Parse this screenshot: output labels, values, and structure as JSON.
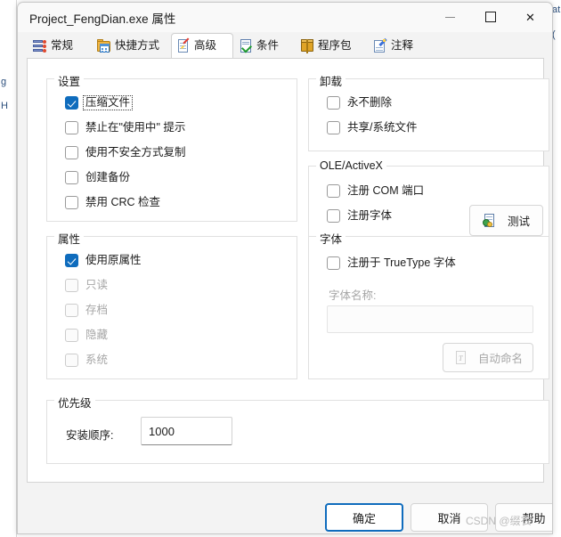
{
  "background": {
    "left_fragments": [
      "g",
      "H"
    ],
    "right_fragments": [
      "at",
      "("
    ]
  },
  "window": {
    "title": "Project_FengDian.exe 属性",
    "controls": {
      "minimize": "minimize-icon",
      "maximize": "maximize-icon",
      "close": "close-icon"
    }
  },
  "tabs": [
    {
      "label": "常规",
      "icon": "general-list-icon",
      "active": false
    },
    {
      "label": "快捷方式",
      "icon": "shortcut-folder-icon",
      "active": false
    },
    {
      "label": "高级",
      "icon": "advanced-doc-icon",
      "active": true
    },
    {
      "label": "条件",
      "icon": "condition-check-icon",
      "active": false
    },
    {
      "label": "程序包",
      "icon": "package-box-icon",
      "active": false
    },
    {
      "label": "注释",
      "icon": "comment-pencil-icon",
      "active": false
    }
  ],
  "groups": {
    "settings": {
      "legend": "设置",
      "items": [
        {
          "label": "压缩文件",
          "checked": true,
          "enabled": true,
          "focused": true
        },
        {
          "label": "禁止在\"使用中\" 提示",
          "checked": false,
          "enabled": true,
          "focused": false
        },
        {
          "label": "使用不安全方式复制",
          "checked": false,
          "enabled": true,
          "focused": false
        },
        {
          "label": "创建备份",
          "checked": false,
          "enabled": true,
          "focused": false
        },
        {
          "label": "禁用 CRC 检查",
          "checked": false,
          "enabled": true,
          "focused": false
        }
      ]
    },
    "attributes": {
      "legend": "属性",
      "items": [
        {
          "label": "使用原属性",
          "checked": true,
          "enabled": true,
          "focused": false
        },
        {
          "label": "只读",
          "checked": false,
          "enabled": false,
          "focused": false
        },
        {
          "label": "存档",
          "checked": false,
          "enabled": false,
          "focused": false
        },
        {
          "label": "隐藏",
          "checked": false,
          "enabled": false,
          "focused": false
        },
        {
          "label": "系统",
          "checked": false,
          "enabled": false,
          "focused": false
        }
      ]
    },
    "uninstall": {
      "legend": "卸载",
      "items": [
        {
          "label": "永不删除",
          "checked": false,
          "enabled": true
        },
        {
          "label": "共享/系统文件",
          "checked": false,
          "enabled": true
        }
      ]
    },
    "ole": {
      "legend": "OLE/ActiveX",
      "items": [
        {
          "label": "注册 COM 端口",
          "checked": false,
          "enabled": true
        },
        {
          "label": "注册字体",
          "checked": false,
          "enabled": true
        }
      ],
      "test_button": {
        "label": "测试",
        "icon": "test-doc-icon",
        "enabled": true
      }
    },
    "font": {
      "legend": "字体",
      "register_truetype": {
        "label": "注册于 TrueType 字体",
        "checked": false,
        "enabled": true
      },
      "name_label": "字体名称:",
      "name_value": "",
      "name_enabled": false,
      "auto_button": {
        "label": "自动命名",
        "icon": "auto-name-icon",
        "enabled": false
      }
    },
    "priority": {
      "legend": "优先级",
      "order_label": "安装顺序:",
      "order_value": "1000"
    }
  },
  "dialog_buttons": [
    {
      "label": "确定",
      "default": true
    },
    {
      "label": "取消",
      "default": false
    },
    {
      "label": "帮助",
      "default": false
    }
  ],
  "watermark": "CSDN @缀衣",
  "colors": {
    "accent": "#0f6cbd",
    "window_bg": "#f3f3f3",
    "page_bg": "#ffffff",
    "disabled_text": "#a6a6a6"
  }
}
